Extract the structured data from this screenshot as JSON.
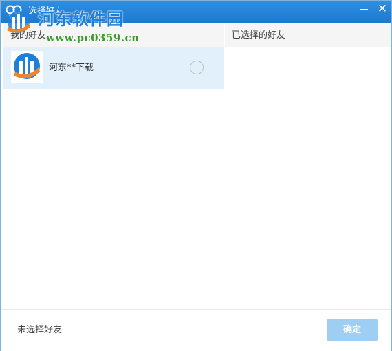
{
  "window": {
    "title": "选择好友",
    "close_glyph": "✕",
    "minimize_icon": "minimize-icon"
  },
  "watermark": {
    "site_name": "河东软件园",
    "url": "www.pc0359.cn"
  },
  "friends_panel": {
    "header": "我的好友",
    "items": [
      {
        "name": "河东**下载",
        "avatar_icon": "brand-logo-avatar",
        "selected": false
      }
    ]
  },
  "selected_panel": {
    "header": "已选择的好友"
  },
  "footer": {
    "status": "未选择好友",
    "confirm_label": "确定"
  },
  "colors": {
    "titlebar": "#2485d9",
    "row_highlight": "#e2f0fb",
    "confirm_disabled": "#9ecff2",
    "watermark_blue": "#1e7fd9",
    "watermark_green": "#3a9b2e",
    "logo_orange": "#f0842b"
  }
}
